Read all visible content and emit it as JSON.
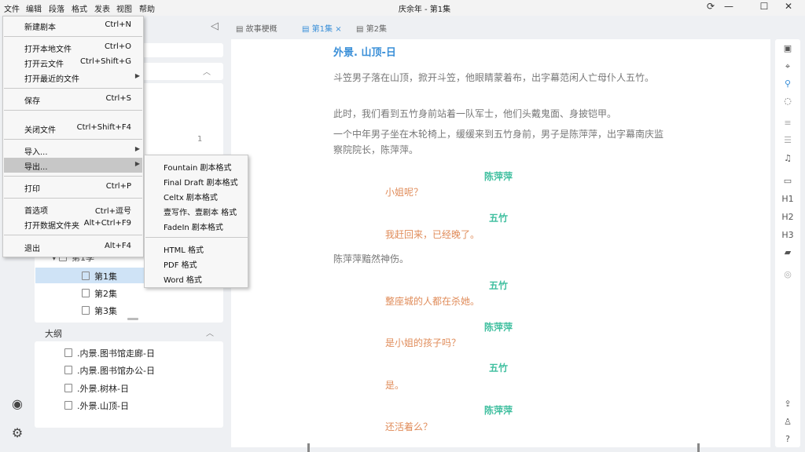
{
  "menubar": {
    "items": [
      "文件",
      "编辑",
      "段落",
      "格式",
      "发表",
      "视图",
      "帮助"
    ],
    "window_title": "庆余年 - 第1集"
  },
  "left_panel": {
    "count_badge": "1",
    "tree": [
      {
        "label": "第1季"
      },
      {
        "label": "第1集"
      },
      {
        "label": "第2集"
      },
      {
        "label": "第3集"
      }
    ],
    "outline": {
      "title": "大纲",
      "items": [
        ".内景.图书馆走廊-日",
        ".内景.图书馆办公-日",
        ".外景.树林-日",
        ".外景.山顶-日"
      ]
    }
  },
  "tabs": [
    {
      "label": "故事梗概"
    },
    {
      "label": "第1集",
      "close": "×"
    },
    {
      "label": "第2集"
    }
  ],
  "script": {
    "scene_heading": "外景. 山顶-日",
    "actions": [
      "斗笠男子落在山顶，掀开斗笠，他眼睛蒙着布，出字幕范闲人亡母仆人五竹。",
      "此时，我们看到五竹身前站着一队军士，他们头戴鬼面、身披铠甲。",
      "一个中年男子坐在木轮椅上，缓缓来到五竹身前，男子是陈萍萍，出字幕南庆监察院院长，陈萍萍。",
      "陈萍萍黯然神伤。"
    ],
    "dialogues": [
      {
        "character": "陈萍萍",
        "line": "小姐呢？"
      },
      {
        "character": "五竹",
        "line": "我赶回来，已经晚了。"
      },
      {
        "character": "五竹",
        "line": "整座城的人都在杀她。"
      },
      {
        "character": "陈萍萍",
        "line": "是小姐的孩子吗？"
      },
      {
        "character": "五竹",
        "line": "是。"
      },
      {
        "character": "陈萍萍",
        "line": "还活着么？"
      }
    ]
  },
  "right_rail": {
    "h_labels": [
      "H1",
      "H2",
      "H3"
    ]
  },
  "file_menu": {
    "items": [
      {
        "label": "新建剧本",
        "shortcut": "Ctrl+N"
      },
      {
        "label": "打开本地文件",
        "shortcut": "Ctrl+O"
      },
      {
        "label": "打开云文件",
        "shortcut": "Ctrl+Shift+G"
      },
      {
        "label": "打开最近的文件",
        "shortcut": "",
        "submenu": "▶"
      },
      {
        "label": "保存",
        "shortcut": "Ctrl+S"
      },
      {
        "label": "关闭文件",
        "shortcut": "Ctrl+Shift+F4"
      },
      {
        "label": "导入...",
        "shortcut": "",
        "submenu": "▶"
      },
      {
        "label": "导出...",
        "shortcut": "",
        "submenu": "▶"
      },
      {
        "label": "打印",
        "shortcut": "Ctrl+P"
      },
      {
        "label": "首选项",
        "shortcut": "Ctrl+逗号"
      },
      {
        "label": "打开数据文件夹",
        "shortcut": "Alt+Ctrl+F9"
      },
      {
        "label": "退出",
        "shortcut": "Alt+F4"
      }
    ]
  },
  "export_submenu": {
    "items": [
      "Fountain 剧本格式",
      "Final Draft 剧本格式",
      "Celtx 剧本格式",
      "壹写作、壹剧本 格式",
      "FadeIn 剧本格式",
      "HTML 格式",
      "PDF 格式",
      "Word 格式"
    ]
  },
  "colors": {
    "accent": "#3a8fd8",
    "character": "#3fbf9f",
    "dialogue": "#e08c5a",
    "action": "#777777"
  }
}
